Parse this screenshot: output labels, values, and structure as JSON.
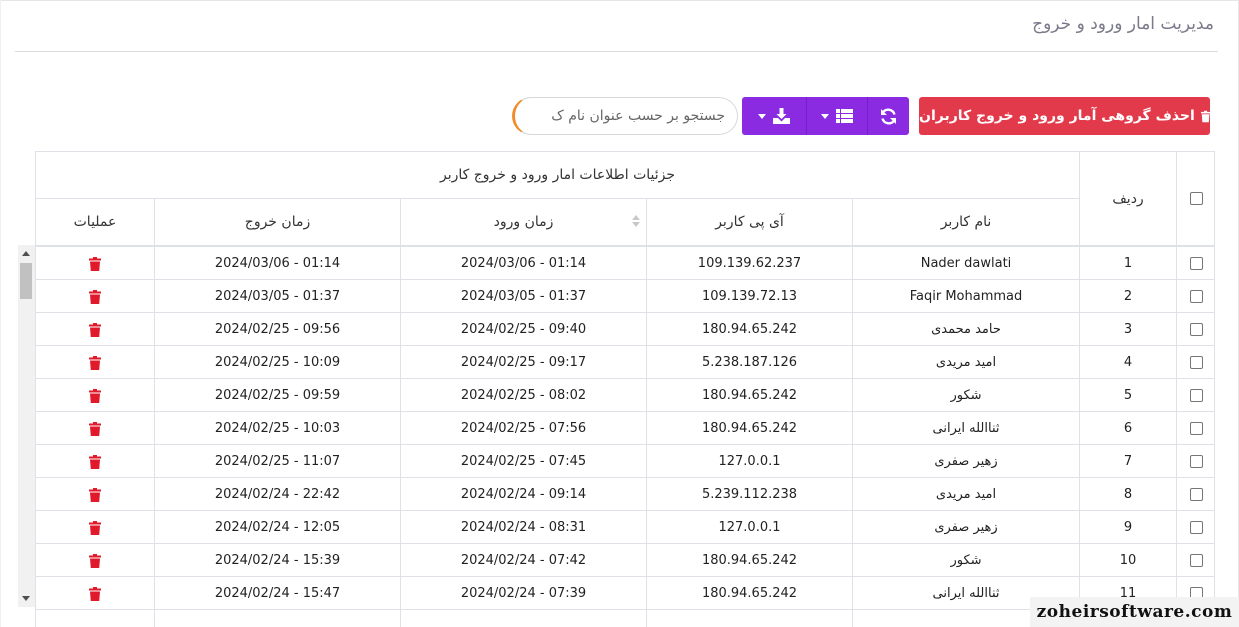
{
  "header": {
    "title": "مدیریت امار ورود و خروج"
  },
  "toolbar": {
    "bulk_delete_label": "احذف گروهی آمار ورود و خروج کاربران",
    "search_placeholder": "جستجو بر حسب عنوان نام ک"
  },
  "table": {
    "group_header": "جزئیات اطلاعات امار ورود و خروج کاربر",
    "columns": {
      "row": "ردیف",
      "username": "نام کاربر",
      "ip": "آی پی کاربر",
      "login": "زمان ورود",
      "logout": "زمان خروج",
      "actions": "عملیات"
    },
    "rows": [
      {
        "n": "1",
        "user": "Nader dawlati",
        "ip": "109.139.62.237",
        "login": "2024/03/06 - 01:14",
        "logout": "2024/03/06 - 01:14"
      },
      {
        "n": "2",
        "user": "Faqir Mohammad",
        "ip": "109.139.72.13",
        "login": "2024/03/05 - 01:37",
        "logout": "2024/03/05 - 01:37"
      },
      {
        "n": "3",
        "user": "حامد محمدی",
        "ip": "180.94.65.242",
        "login": "2024/02/25 - 09:40",
        "logout": "2024/02/25 - 09:56"
      },
      {
        "n": "4",
        "user": "امید مریدی",
        "ip": "5.238.187.126",
        "login": "2024/02/25 - 09:17",
        "logout": "2024/02/25 - 10:09"
      },
      {
        "n": "5",
        "user": "شکور",
        "ip": "180.94.65.242",
        "login": "2024/02/25 - 08:02",
        "logout": "2024/02/25 - 09:59"
      },
      {
        "n": "6",
        "user": "ثناالله ایرانی",
        "ip": "180.94.65.242",
        "login": "2024/02/25 - 07:56",
        "logout": "2024/02/25 - 10:03"
      },
      {
        "n": "7",
        "user": "زهیر صفری",
        "ip": "127.0.0.1",
        "login": "2024/02/25 - 07:45",
        "logout": "2024/02/25 - 11:07"
      },
      {
        "n": "8",
        "user": "امید مریدی",
        "ip": "5.239.112.238",
        "login": "2024/02/24 - 09:14",
        "logout": "2024/02/24 - 22:42"
      },
      {
        "n": "9",
        "user": "زهیر صفری",
        "ip": "127.0.0.1",
        "login": "2024/02/24 - 08:31",
        "logout": "2024/02/24 - 12:05"
      },
      {
        "n": "10",
        "user": "شکور",
        "ip": "180.94.65.242",
        "login": "2024/02/24 - 07:42",
        "logout": "2024/02/24 - 15:39"
      },
      {
        "n": "11",
        "user": "ثناالله ایرانی",
        "ip": "180.94.65.242",
        "login": "2024/02/24 - 07:39",
        "logout": "2024/02/24 - 15:47"
      }
    ]
  },
  "icons": {
    "trash": "trash-icon",
    "refresh": "refresh-icon",
    "columns": "list-icon",
    "export": "download-icon"
  },
  "colors": {
    "danger": "#e23a4a",
    "primary": "#8a2be2",
    "search_accent": "#f08c2a"
  },
  "watermark": "zoheirsoftware.com"
}
